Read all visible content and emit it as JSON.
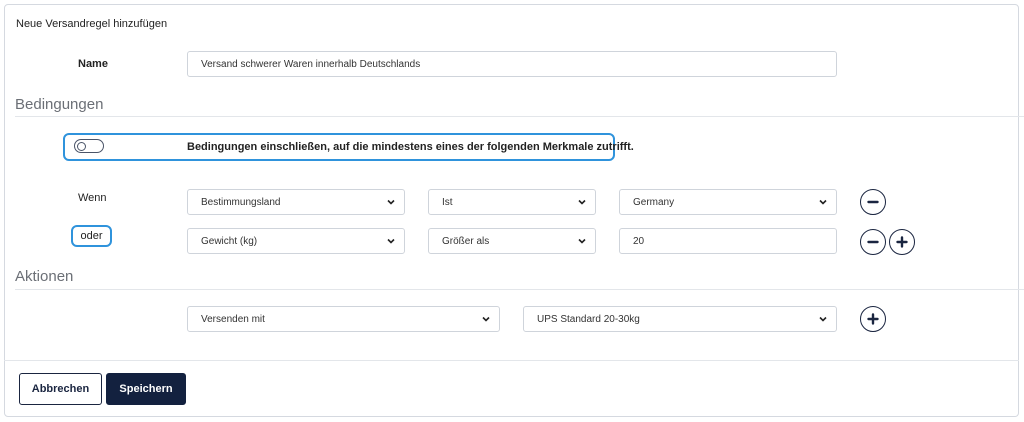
{
  "dialog": {
    "title": "Neue Versandregel hinzufügen"
  },
  "name_field": {
    "label": "Name",
    "value": "Versand schwerer Waren innerhalb Deutschlands"
  },
  "conditions": {
    "section_title": "Bedingungen",
    "toggle_label": "Bedingungen einschließen, auf die mindestens eines der folgenden Merkmale zutrifft.",
    "toggle_on": false,
    "rows": [
      {
        "prefix": "Wenn",
        "attribute": "Bestimmungsland",
        "operator": "Ist",
        "value": "Germany"
      },
      {
        "prefix": "oder",
        "attribute": "Gewicht (kg)",
        "operator": "Größer als",
        "value": "20"
      }
    ]
  },
  "actions": {
    "section_title": "Aktionen",
    "action": "Versenden mit",
    "method": "UPS Standard 20-30kg"
  },
  "footer": {
    "cancel_label": "Abbrechen",
    "save_label": "Speichern"
  },
  "colors": {
    "accent": "#2f93dc",
    "primary": "#13213f",
    "border": "#cfd4db"
  }
}
